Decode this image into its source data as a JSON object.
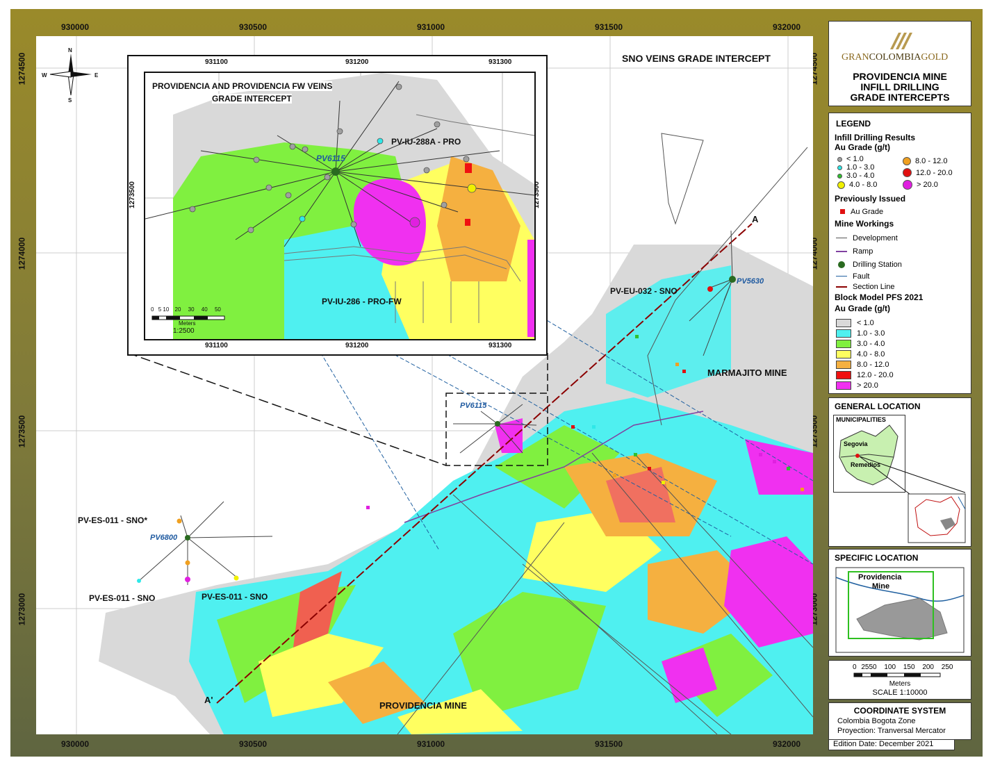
{
  "map_title": "SNO VEINS GRADE INTERCEPT",
  "coords_x": [
    "930000",
    "930500",
    "931000",
    "931500",
    "932000"
  ],
  "coords_y": [
    "1274500",
    "1274000",
    "1273500",
    "1273000"
  ],
  "compass": {
    "n": "N",
    "s": "S",
    "e": "E",
    "w": "W"
  },
  "inset": {
    "title_line1": "PROVIDENCIA AND PROVIDENCIA FW VEINS",
    "title_line2": "GRADE INTERCEPT",
    "coords_x": [
      "931100",
      "931200",
      "931300"
    ],
    "coord_y": "1273500",
    "station": "PV6115",
    "hole1": "PV-IU-288A - PRO",
    "hole2": "PV-IU-286 - PRO-FW",
    "scale_ticks": [
      "0",
      "5",
      "10",
      "20",
      "30",
      "40",
      "50"
    ],
    "scale_unit": "Meters",
    "scale_ratio": "1:2500"
  },
  "labels": {
    "marmajito": "MARMAJITO MINE",
    "providencia": "PROVIDENCIA MINE",
    "section_a": "A",
    "section_a_prime": "A'",
    "pv5630": "PV5630",
    "pv6115": "PV6115",
    "pv6800": "PV6800",
    "eu032": "PV-EU-032 - SNO",
    "es011a": "PV-ES-011 - SNO*",
    "es011b": "PV-ES-011 - SNO",
    "es011c": "PV-ES-011 - SNO"
  },
  "header": {
    "logo_gran": "GRAN",
    "logo_colombia": "COLOMBIA",
    "logo_gold": "GOLD",
    "title_line1": "PROVIDENCIA MINE",
    "title_line2": "INFILL DRILLING",
    "title_line3": "GRADE INTERCEPTS"
  },
  "legend": {
    "title": "LEGEND",
    "infill_title": "Infill Drilling Results",
    "infill_sub": "Au Grade (g/t)",
    "infill_classes": [
      {
        "label": "< 1.0",
        "color": "#a0a0a0"
      },
      {
        "label": "1.0 - 3.0",
        "color": "#2ee8e8"
      },
      {
        "label": "3.0 - 4.0",
        "color": "#30c030"
      },
      {
        "label": "4.0 - 8.0",
        "color": "#f0f000"
      },
      {
        "label": "8.0 - 12.0",
        "color": "#f0a020"
      },
      {
        "label": "12.0 - 20.0",
        "color": "#e01010"
      },
      {
        "label": "> 20.0",
        "color": "#e020e0"
      }
    ],
    "prev_title": "Previously Issued",
    "prev_item": "Au Grade",
    "workings_title": "Mine Workings",
    "development": "Development",
    "ramp": "Ramp",
    "drilling_station": "Drilling Station",
    "fault": "Fault",
    "section_line": "Section Line",
    "block_title": "Block Model PFS 2021",
    "block_sub": "Au Grade (g/t)",
    "block_classes": [
      {
        "label": "< 1.0",
        "color": "#d9d9d9"
      },
      {
        "label": "1.0 - 3.0",
        "color": "#4ff0f0"
      },
      {
        "label": "3.0 - 4.0",
        "color": "#80f040"
      },
      {
        "label": "4.0 - 8.0",
        "color": "#ffff60"
      },
      {
        "label": "8.0 - 12.0",
        "color": "#f5b040"
      },
      {
        "label": "12.0 - 20.0",
        "color": "#f01010"
      },
      {
        "label": "> 20.0",
        "color": "#f030f0"
      }
    ]
  },
  "general_location": {
    "title": "GENERAL LOCATION",
    "municipalities": "MUNICIPALITIES",
    "segovia": "Segovia",
    "remedios": "Remedios"
  },
  "specific_location": {
    "title": "SPECIFIC LOCATION",
    "name_line1": "Providencia",
    "name_line2": "Mine"
  },
  "scale": {
    "ticks": [
      "0",
      "25",
      "50",
      "100",
      "150",
      "200",
      "250"
    ],
    "unit": "Meters",
    "ratio": "SCALE 1:10000"
  },
  "coordinate_system": {
    "title": "COORDINATE SYSTEM",
    "line1": "Colombia Bogota Zone",
    "line2": "Proyection: Tranversal Mercator"
  },
  "edition": "Edition Date: December 2021"
}
